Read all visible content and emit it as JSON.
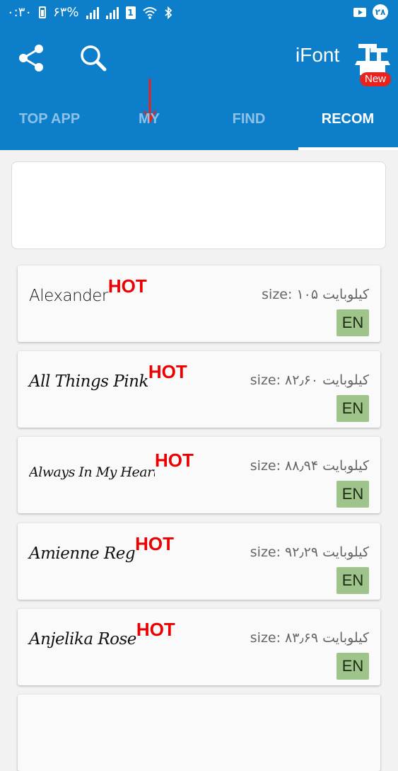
{
  "status_bar": {
    "time": "۰:۳۰",
    "battery": "۶۳%",
    "sim_label": "1",
    "notification_count": "۲۸"
  },
  "app": {
    "title": "iFont",
    "icons": {
      "share": "share-icon",
      "search": "search-icon",
      "logo": "ifont-logo-icon"
    }
  },
  "tabs": [
    {
      "label": "TOP APP",
      "active": false
    },
    {
      "label": "MY",
      "active": false
    },
    {
      "label": "FIND",
      "active": false
    },
    {
      "label": "RECOM",
      "active": true
    }
  ],
  "new_badge": "New",
  "annotation": {
    "arrow_color": "#e8221d"
  },
  "colors": {
    "primary": "#0d7fca",
    "hot": "#ee0000",
    "lang_badge": "#9fc48b"
  },
  "fonts": [
    {
      "name": "Alexander",
      "hot": "HOT",
      "size": "size: ۱۰۵ کیلوبایت",
      "lang": "EN"
    },
    {
      "name": "All Things Pink",
      "hot": "HOT",
      "size": "size: ۸۲٫۶۰ کیلوبایت",
      "lang": "EN"
    },
    {
      "name": "Always In My Heart",
      "hot": "HOT",
      "size": "size: ۸۸٫۹۴ کیلوبایت",
      "lang": "EN"
    },
    {
      "name": "Amienne Reg",
      "hot": "HOT",
      "size": "size: ۹۲٫۲۹ کیلوبایت",
      "lang": "EN"
    },
    {
      "name": "Anjelika Rose",
      "hot": "HOT",
      "size": "size: ۸۳٫۶۹ کیلوبایت",
      "lang": "EN"
    }
  ]
}
